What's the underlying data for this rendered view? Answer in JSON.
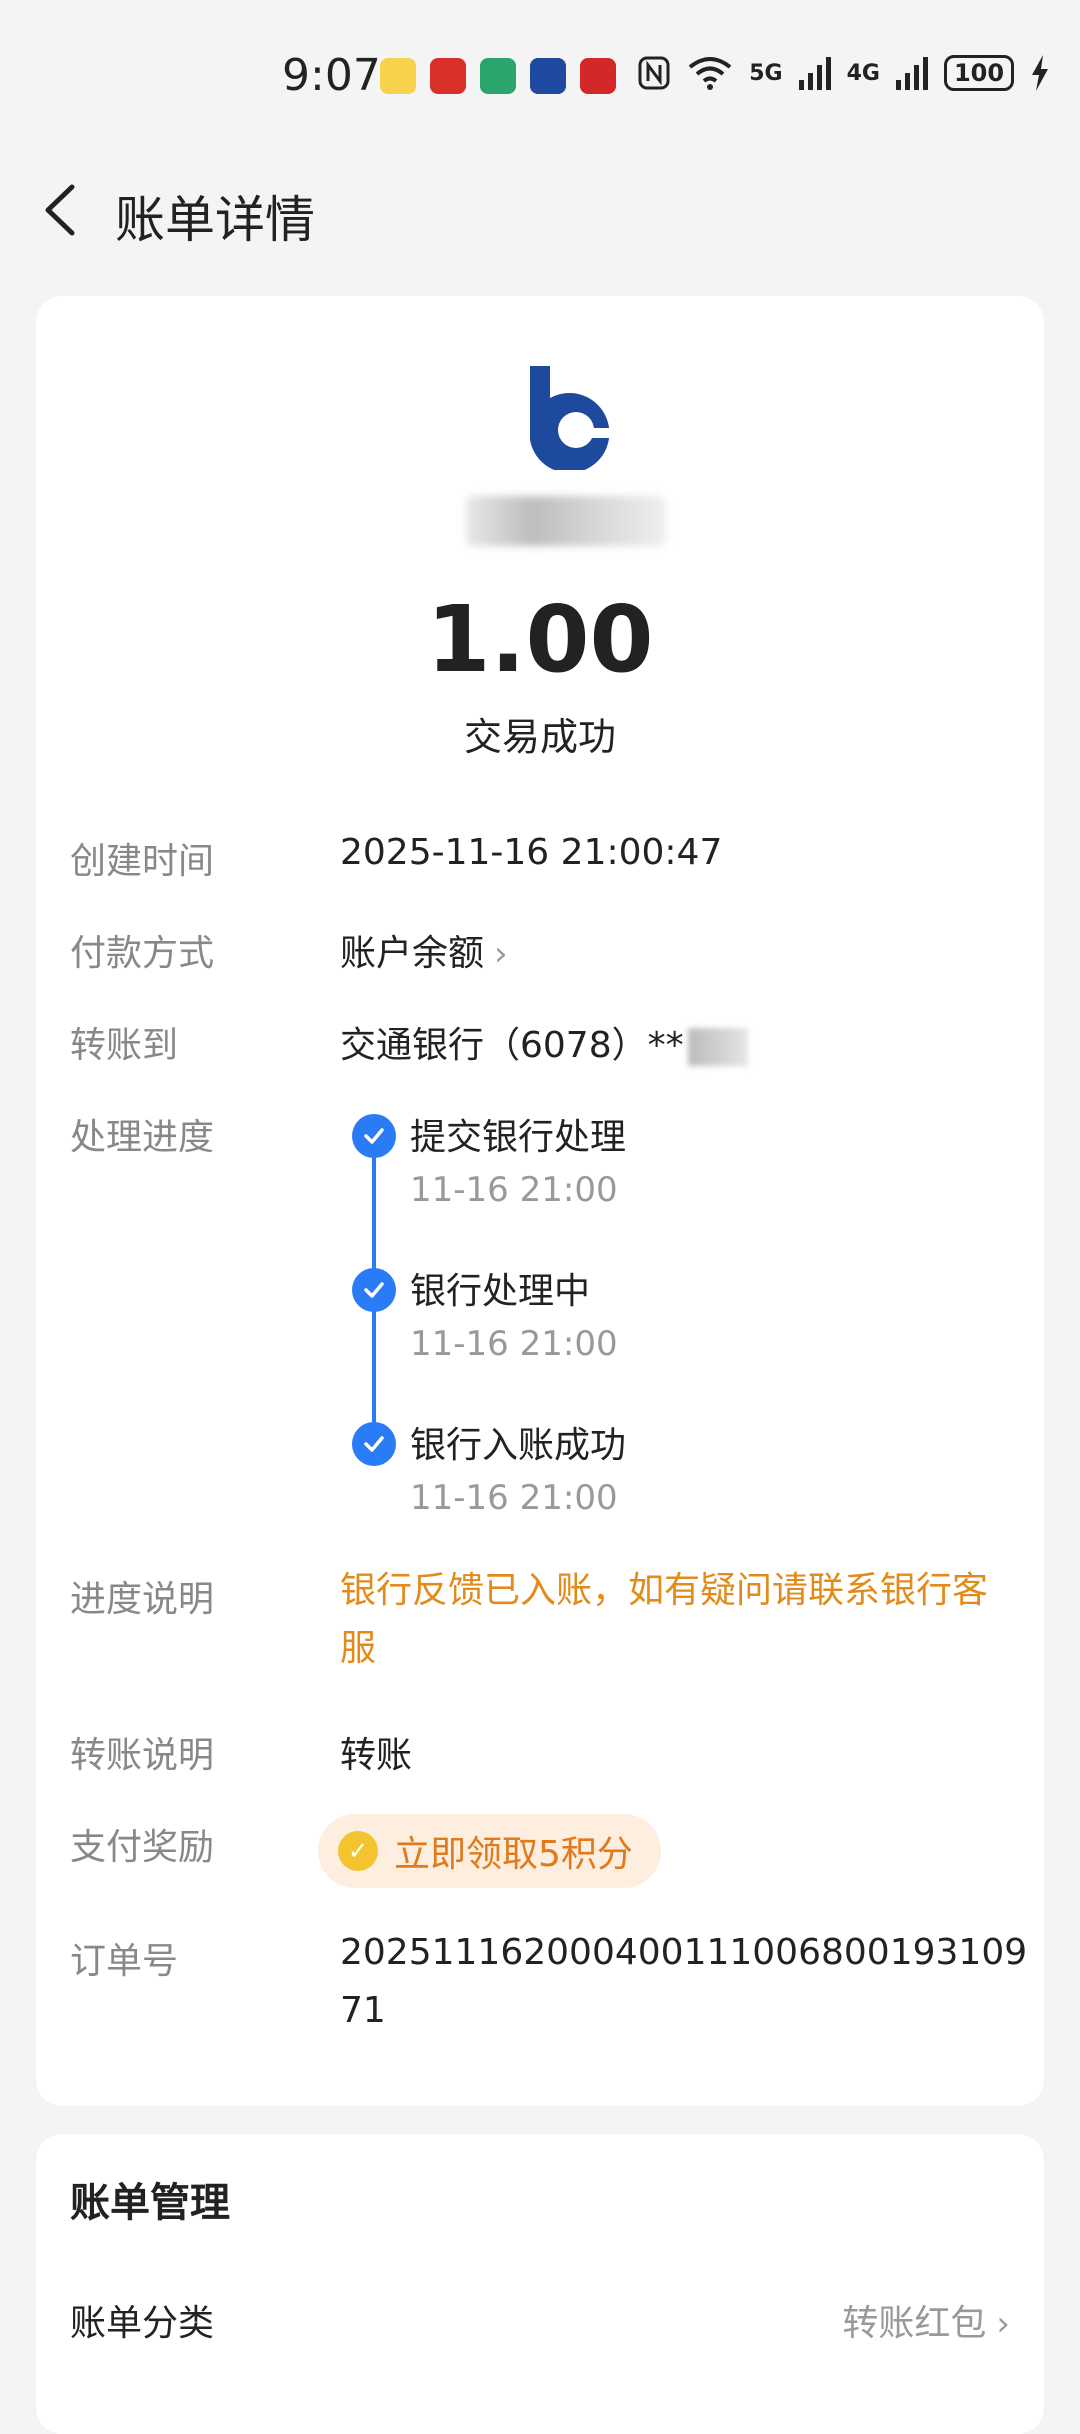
{
  "status_bar": {
    "time": "9:07",
    "signal_5g": "5G",
    "signal_4g": "4G",
    "battery": "100"
  },
  "header": {
    "title": "账单详情"
  },
  "summary": {
    "amount": "1.00",
    "status": "交易成功"
  },
  "details": {
    "created_label": "创建时间",
    "created_value": "2025-11-16 21:00:47",
    "payment_label": "付款方式",
    "payment_value": "账户余额",
    "transfer_label": "转账到",
    "transfer_value": "交通银行（6078）**",
    "progress_label": "处理进度",
    "steps": [
      {
        "title": "提交银行处理",
        "time": "11-16 21:00"
      },
      {
        "title": "银行处理中",
        "time": "11-16 21:00"
      },
      {
        "title": "银行入账成功",
        "time": "11-16 21:00"
      }
    ],
    "progress_note_label": "进度说明",
    "progress_note_value": "银行反馈已入账，如有疑问请联系银行客服",
    "memo_label": "转账说明",
    "memo_value": "转账",
    "reward_label": "支付奖励",
    "reward_value": "立即领取5积分",
    "order_label": "订单号",
    "order_value": "20251116200040011100680019310971"
  },
  "manage": {
    "title": "账单管理",
    "category_label": "账单分类",
    "category_value": "转账红包"
  },
  "colors": {
    "accent_blue": "#2a7bf6",
    "warning_orange": "#e38b1a",
    "background": "#f4f4f4"
  }
}
